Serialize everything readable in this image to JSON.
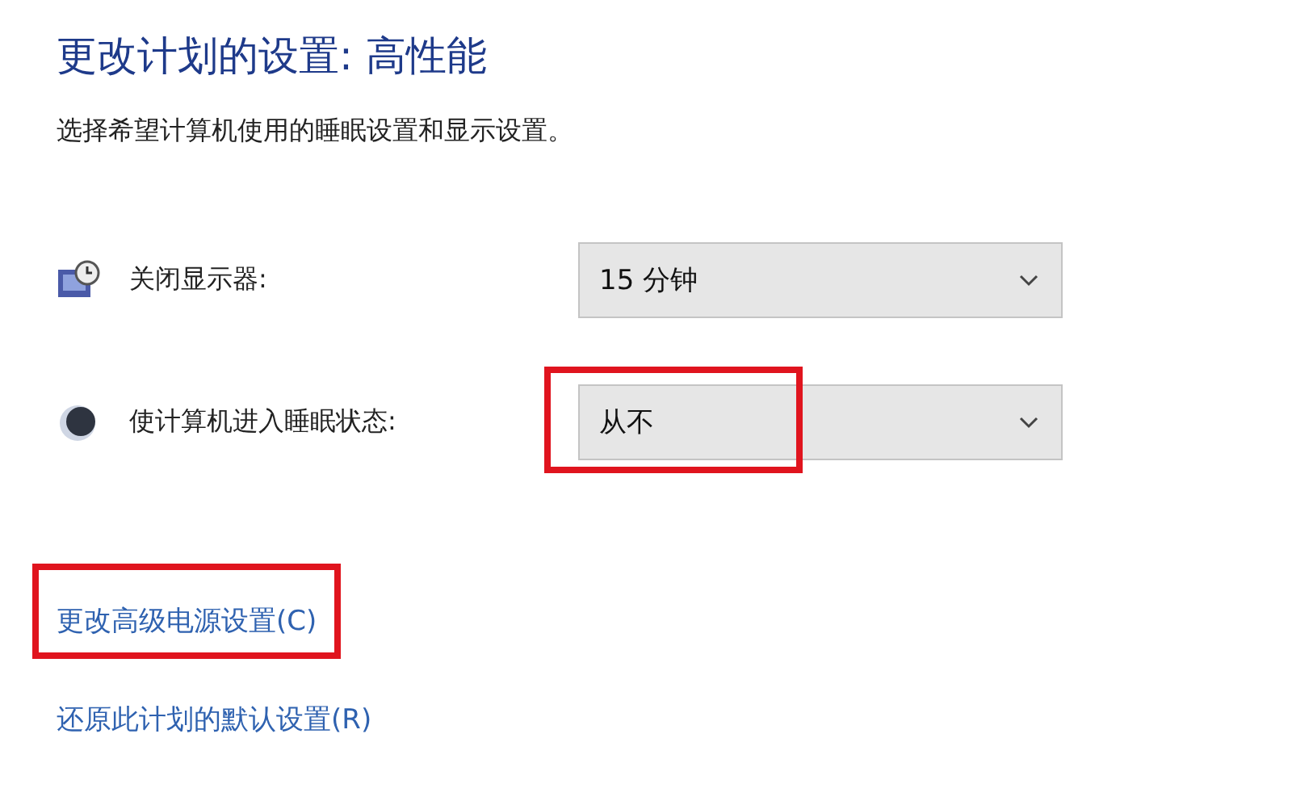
{
  "title": "更改计划的设置: 高性能",
  "subtitle": "选择希望计算机使用的睡眠设置和显示设置。",
  "settings": [
    {
      "kind": "display",
      "label": "关闭显示器:",
      "value": "15 分钟",
      "highlighted": false
    },
    {
      "kind": "sleep",
      "label": "使计算机进入睡眠状态:",
      "value": "从不",
      "highlighted": true
    }
  ],
  "links": [
    {
      "label": "更改高级电源设置(C)",
      "highlighted": true
    },
    {
      "label": "还原此计划的默认设置(R)",
      "highlighted": false
    }
  ]
}
